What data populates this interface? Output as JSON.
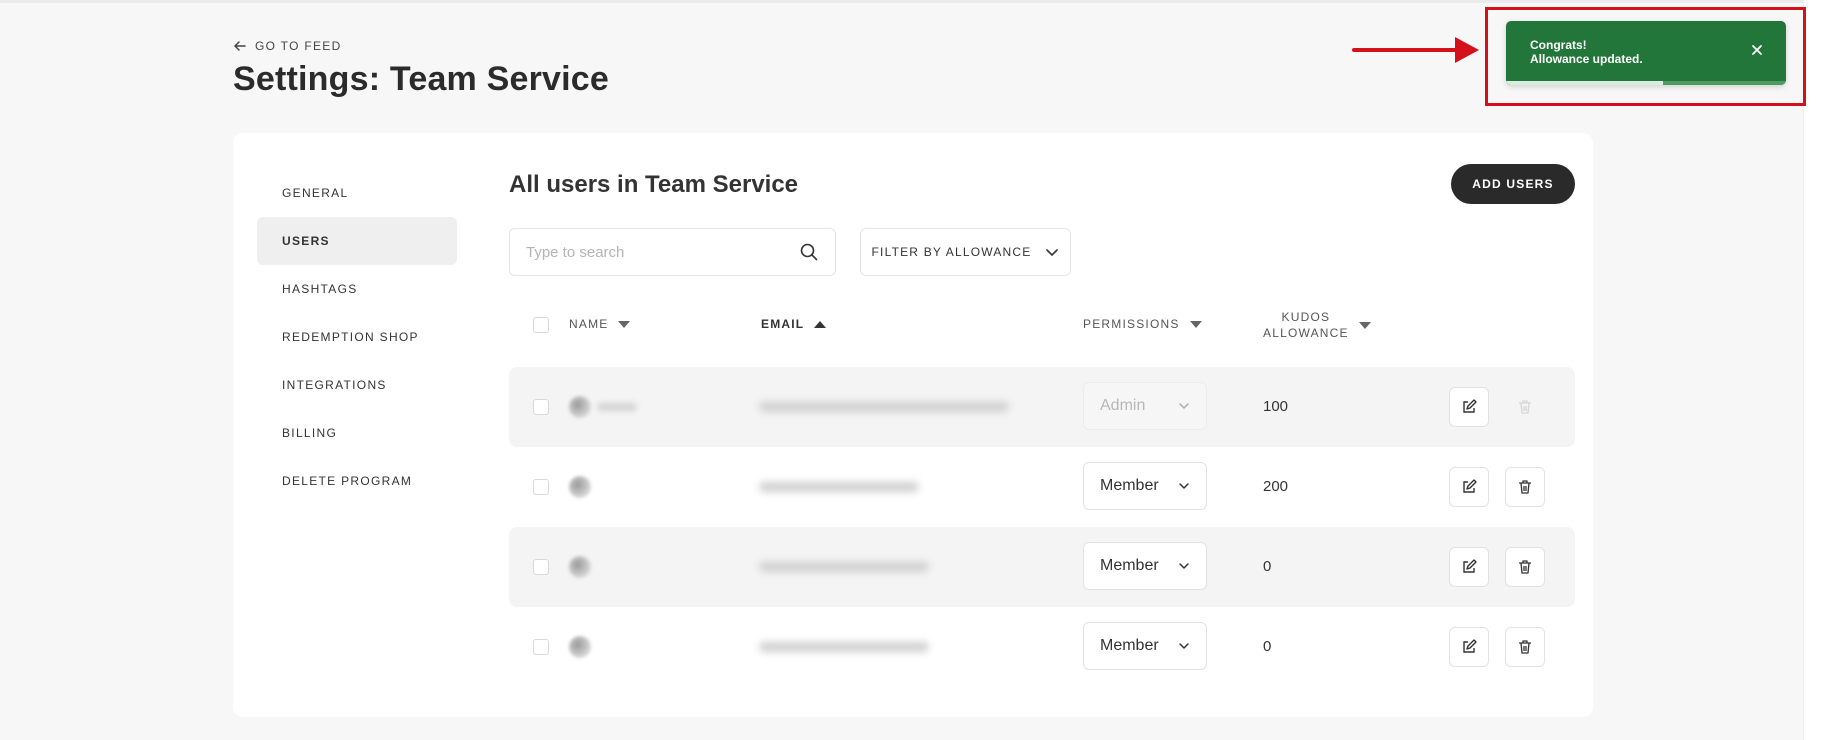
{
  "header": {
    "back_link": "GO TO FEED",
    "page_title": "Settings: Team Service"
  },
  "sidebar": {
    "items": [
      {
        "label": "GENERAL",
        "active": false
      },
      {
        "label": "USERS",
        "active": true
      },
      {
        "label": "HASHTAGS",
        "active": false
      },
      {
        "label": "REDEMPTION SHOP",
        "active": false
      },
      {
        "label": "INTEGRATIONS",
        "active": false
      },
      {
        "label": "BILLING",
        "active": false
      },
      {
        "label": "DELETE PROGRAM",
        "active": false
      }
    ]
  },
  "main": {
    "title": "All users in Team Service",
    "add_users_label": "ADD USERS",
    "search_placeholder": "Type to search",
    "filter_label": "FILTER BY ALLOWANCE"
  },
  "table": {
    "columns": {
      "name": "NAME",
      "email": "EMAIL",
      "permissions": "PERMISSIONS",
      "kudos_line1": "KUDOS",
      "kudos_line2": "ALLOWANCE"
    },
    "rows": [
      {
        "permission": "Admin",
        "allowance": "100",
        "disabled": true
      },
      {
        "permission": "Member",
        "allowance": "200",
        "disabled": false
      },
      {
        "permission": "Member",
        "allowance": "0",
        "disabled": false
      },
      {
        "permission": "Member",
        "allowance": "0",
        "disabled": false
      }
    ]
  },
  "toast": {
    "title": "Congrats!",
    "message": "Allowance updated.",
    "progress_fraction": 0.56,
    "color": "#23763a"
  },
  "colors": {
    "annotation_red": "#d4101b",
    "button_dark": "#2a2a2a"
  }
}
